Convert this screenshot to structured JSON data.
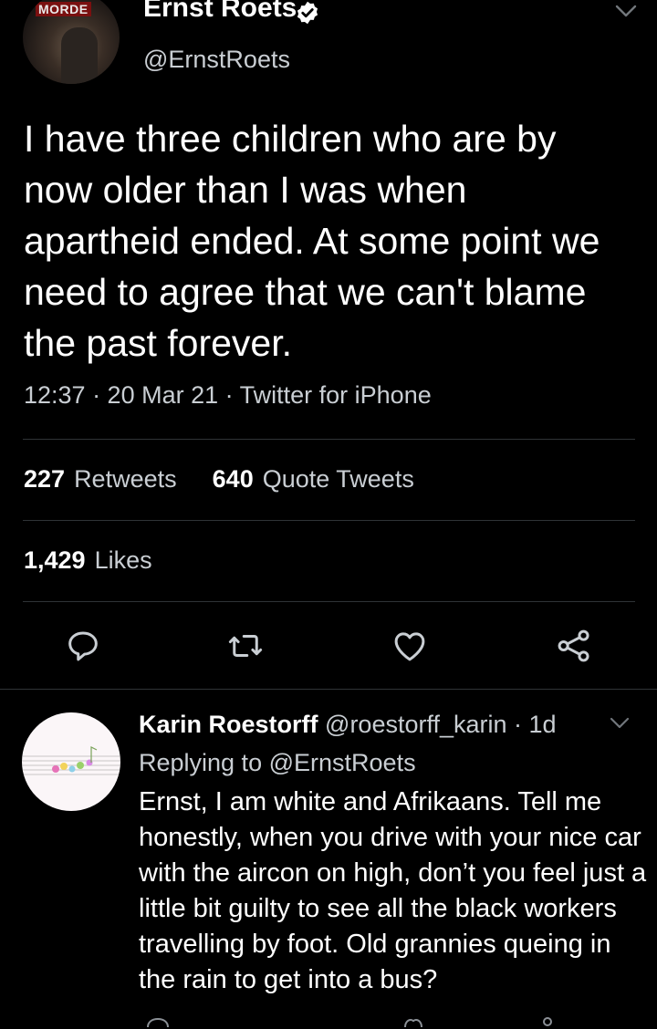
{
  "tweet": {
    "author_name": "Ernst Roets",
    "author_handle": "@ErnstRoets",
    "avatar_badge": "MORDE",
    "text": "I have three children who are by now older than I was when apartheid ended. At some point we need to agree that we can't blame the past forever.",
    "meta": "12:37 · 20 Mar 21 · Twitter for iPhone",
    "retweets_count": "227",
    "retweets_label": "Retweets",
    "quote_count": "640",
    "quote_label": "Quote Tweets",
    "likes_count": "1,429",
    "likes_label": "Likes"
  },
  "reply": {
    "author_name": "Karin Roestorff",
    "author_handle": "@roestorff_karin",
    "time": "· 1d",
    "replying_prefix": "Replying to",
    "replying_handle": "@ErnstRoets",
    "text": "Ernst, I am white and Afrikaans. Tell me honestly, when you drive with your nice car with the aircon on high, don’t you feel just a little bit guilty to see all the black workers travelling by foot. Old grannies queing in the rain to get into a bus?"
  },
  "icons": {
    "reply": "comment-icon",
    "retweet": "retweet-icon",
    "like": "heart-icon",
    "share": "share-icon",
    "verified": "verified-badge-icon",
    "menu": "chevron-down-icon"
  },
  "colors": {
    "background": "#000000",
    "secondary_text": "#c9ced3",
    "divider": "#2f3336",
    "icon": "#c9ced3"
  }
}
